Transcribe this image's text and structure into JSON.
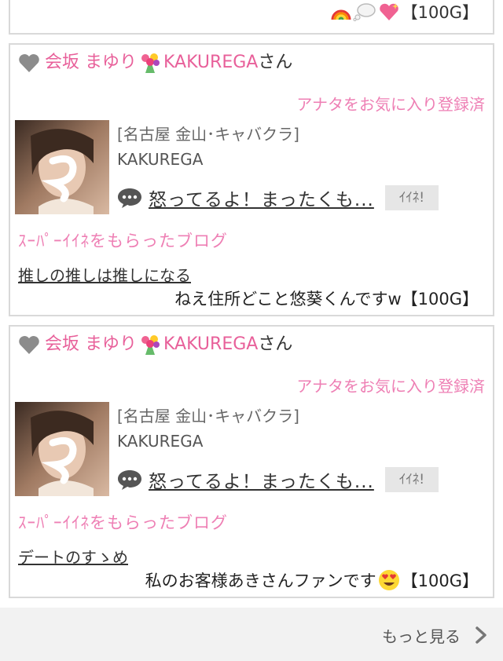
{
  "top_item": {
    "comment_suffix": "【100G】"
  },
  "cards": [
    {
      "name": "会坂 まゆり",
      "shop_tag": "KAKUREGA",
      "honorific": "さん",
      "fav_status": "アナタをお気に入り登録済",
      "category": "[名古屋 金山･キャバクラ]",
      "shop": "KAKUREGA",
      "latest_comment": "怒ってるよ！まったくも...",
      "iine_label": "ｲｲﾈ!",
      "super_label": "ｽｰﾊﾟｰｲｲﾈをもらったブログ",
      "blog_title": "推しの推しは推しになる",
      "blog_comment": "ねえ住所どこと悠葵くんですw",
      "blog_points": "【100G】"
    },
    {
      "name": "会坂 まゆり",
      "shop_tag": "KAKUREGA",
      "honorific": "さん",
      "fav_status": "アナタをお気に入り登録済",
      "category": "[名古屋 金山･キャバクラ]",
      "shop": "KAKUREGA",
      "latest_comment": "怒ってるよ！まったくも...",
      "iine_label": "ｲｲﾈ!",
      "super_label": "ｽｰﾊﾟｰｲｲﾈをもらったブログ",
      "blog_title": "デートのすゝめ",
      "blog_comment": "私のお客様あきさんファンです",
      "blog_points": "【100G】"
    }
  ],
  "more": {
    "label": "もっと見る"
  },
  "colors": {
    "pink": "#e8609a",
    "light_pink": "#ee7fb4",
    "border": "#d9d9d9",
    "iine_bg": "#e6e6e6",
    "more_bg": "#f2f2f2"
  }
}
